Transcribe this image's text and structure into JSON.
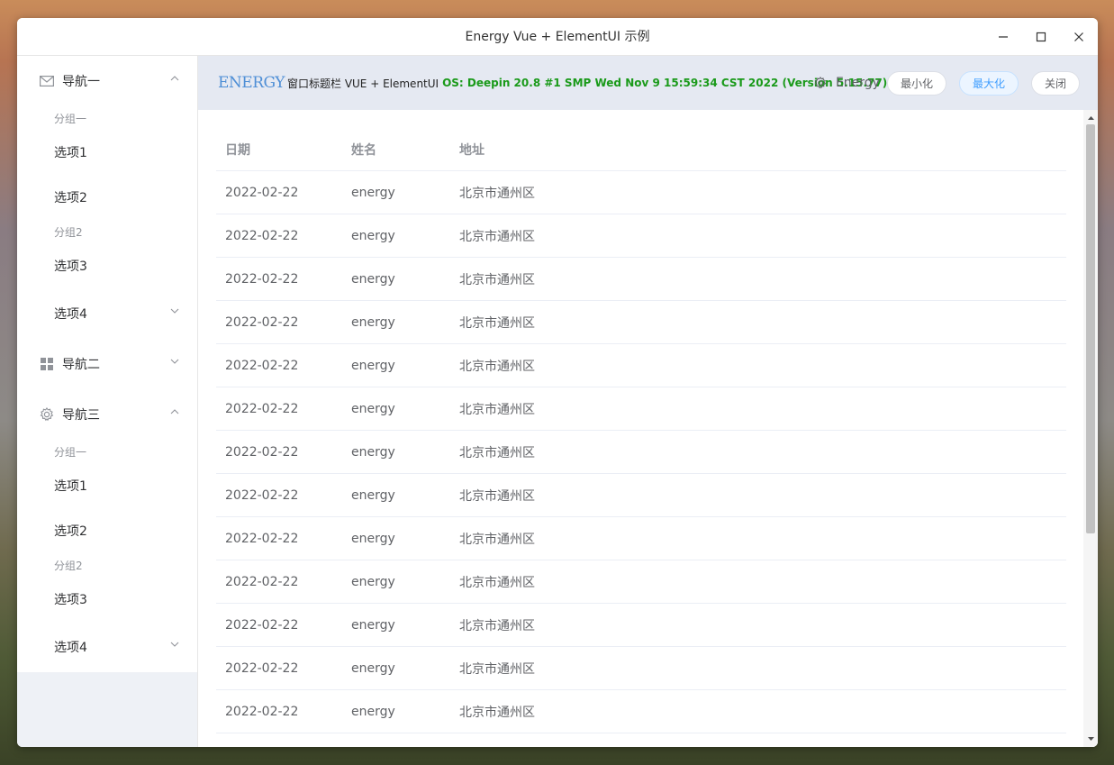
{
  "window": {
    "title": "Energy Vue + ElementUI 示例"
  },
  "sidebar": {
    "menus": [
      {
        "label": "导航一",
        "icon": "mail-icon",
        "groups": [
          {
            "title": "分组一",
            "items": [
              "选项1",
              "选项2"
            ]
          },
          {
            "title": "分组2",
            "items": [
              "选项3"
            ]
          }
        ],
        "submenu": "选项4"
      },
      {
        "label": "导航二",
        "icon": "grid-icon"
      },
      {
        "label": "导航三",
        "icon": "gear-icon",
        "groups": [
          {
            "title": "分组一",
            "items": [
              "选项1",
              "选项2"
            ]
          },
          {
            "title": "分组2",
            "items": [
              "选项3"
            ]
          }
        ],
        "submenu": "选项4"
      }
    ]
  },
  "header": {
    "logo": "ENERGY",
    "label": "窗口标题栏 VUE + ElementUI",
    "os_info": "OS: Deepin 20.8 #1 SMP Wed Nov 9 15:59:34 CST 2022 (Version 5.15.77)",
    "user": "Energy",
    "buttons": {
      "minimize": "最小化",
      "maximize": "最大化",
      "close": "关闭"
    }
  },
  "table": {
    "columns": [
      "日期",
      "姓名",
      "地址"
    ],
    "rows": [
      [
        "2022-02-22",
        "energy",
        "北京市通州区"
      ],
      [
        "2022-02-22",
        "energy",
        "北京市通州区"
      ],
      [
        "2022-02-22",
        "energy",
        "北京市通州区"
      ],
      [
        "2022-02-22",
        "energy",
        "北京市通州区"
      ],
      [
        "2022-02-22",
        "energy",
        "北京市通州区"
      ],
      [
        "2022-02-22",
        "energy",
        "北京市通州区"
      ],
      [
        "2022-02-22",
        "energy",
        "北京市通州区"
      ],
      [
        "2022-02-22",
        "energy",
        "北京市通州区"
      ],
      [
        "2022-02-22",
        "energy",
        "北京市通州区"
      ],
      [
        "2022-02-22",
        "energy",
        "北京市通州区"
      ],
      [
        "2022-02-22",
        "energy",
        "北京市通州区"
      ],
      [
        "2022-02-22",
        "energy",
        "北京市通州区"
      ],
      [
        "2022-02-22",
        "energy",
        "北京市通州区"
      ]
    ]
  },
  "colors": {
    "accent": "#409eff",
    "os_info": "#1a9a1a",
    "logo": "#4f8fd6",
    "header_bg": "#e5e9f2"
  }
}
